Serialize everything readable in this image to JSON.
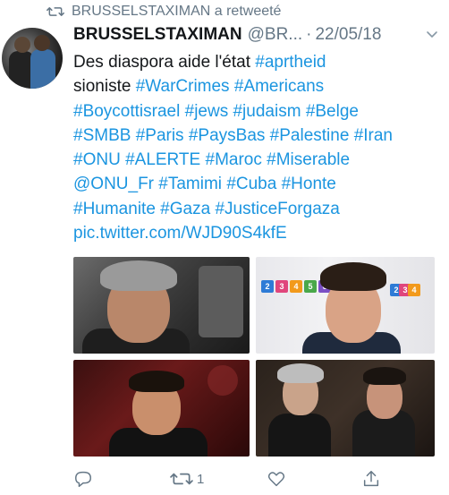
{
  "retweet": {
    "icon": "retweet-icon",
    "text": "BRUSSELSTAXIMAN a retweeté"
  },
  "tweet": {
    "author_name": "BRUSSELSTAXIMAN",
    "handle": "@BR...",
    "separator": "·",
    "date": "22/05/18",
    "text_lines": [
      [
        {
          "t": "Des diaspora aide l'état ",
          "h": false
        },
        {
          "t": "#aprtheid",
          "h": true
        }
      ],
      [
        {
          "t": "sioniste ",
          "h": false
        },
        {
          "t": "#WarCrimes",
          "h": true
        },
        {
          "t": "  ",
          "h": false
        },
        {
          "t": "#Americans",
          "h": true
        }
      ],
      [
        {
          "t": "#Boycottisrael",
          "h": true
        },
        {
          "t": " ",
          "h": false
        },
        {
          "t": "#jews",
          "h": true
        },
        {
          "t": " ",
          "h": false
        },
        {
          "t": "#judaism",
          "h": true
        },
        {
          "t": " ",
          "h": false
        },
        {
          "t": "#Belge",
          "h": true
        }
      ],
      [
        {
          "t": "#SMBB",
          "h": true
        },
        {
          "t": " ",
          "h": false
        },
        {
          "t": "#Paris",
          "h": true
        },
        {
          "t": " ",
          "h": false
        },
        {
          "t": "#PaysBas",
          "h": true
        },
        {
          "t": " ",
          "h": false
        },
        {
          "t": "#Palestine",
          "h": true
        },
        {
          "t": " ",
          "h": false
        },
        {
          "t": "#Iran",
          "h": true
        }
      ],
      [
        {
          "t": "#ONU",
          "h": true
        },
        {
          "t": " ",
          "h": false
        },
        {
          "t": "#ALERTE",
          "h": true
        },
        {
          "t": " ",
          "h": false
        },
        {
          "t": "#Maroc",
          "h": true
        },
        {
          "t": " ",
          "h": false
        },
        {
          "t": "#Miserable",
          "h": true
        }
      ],
      [
        {
          "t": "@ONU_Fr",
          "h": true
        },
        {
          "t": " ",
          "h": false
        },
        {
          "t": "#Tamimi",
          "h": true
        },
        {
          "t": " ",
          "h": false
        },
        {
          "t": "#Cuba",
          "h": true
        },
        {
          "t": " ",
          "h": false
        },
        {
          "t": "#Honte",
          "h": true
        }
      ],
      [
        {
          "t": "#Humanite",
          "h": true
        },
        {
          "t": " ",
          "h": false
        },
        {
          "t": "#Gaza",
          "h": true
        },
        {
          "t": " ",
          "h": false
        },
        {
          "t": "#JusticeForgaza",
          "h": true
        }
      ],
      [
        {
          "t": "pic.twitter.com/WJD90S4kfE",
          "h": true
        }
      ]
    ]
  },
  "images": [
    {
      "name": "photo-1"
    },
    {
      "name": "photo-2",
      "tiles": [
        "2",
        "3",
        "4",
        "5",
        "6"
      ]
    },
    {
      "name": "photo-3"
    },
    {
      "name": "photo-4"
    }
  ],
  "actions": {
    "reply_icon": "reply-icon",
    "retweet_icon": "retweet-icon",
    "retweet_count": "1",
    "like_icon": "heart-icon",
    "share_icon": "share-icon"
  },
  "colors": {
    "link": "#1b95e0",
    "secondary": "#657786",
    "text": "#14171a"
  }
}
